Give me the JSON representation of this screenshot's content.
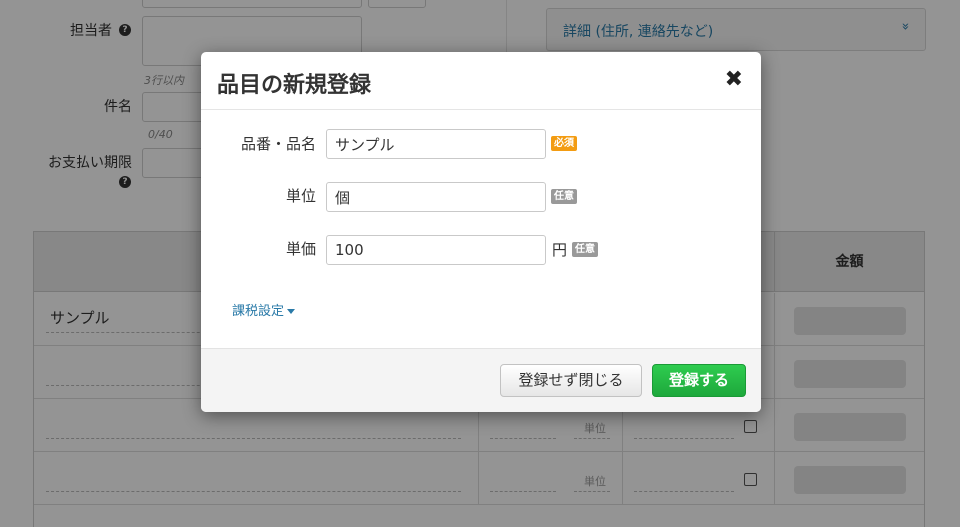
{
  "background": {
    "assignee_label": "担当者",
    "assignee_hint": "3行以内",
    "subject_label": "件名",
    "subject_counter": "0/40",
    "payment_due_label": "お支払い期限",
    "help_glyph": "?",
    "detail_toggle": "詳細 (住所, 連絡先など)",
    "detail_chevron": "»",
    "table": {
      "amount_header": "金額",
      "first_row_name": "サンプル",
      "unit_placeholder": "単位"
    }
  },
  "modal": {
    "title": "品目の新規登録",
    "close_glyph": "✖",
    "fields": {
      "name_label": "品番・品名",
      "name_value": "サンプル",
      "required_badge": "必須",
      "unit_label": "単位",
      "unit_value": "個",
      "price_label": "単価",
      "price_value": "100",
      "currency": "円",
      "optional_badge": "任意"
    },
    "tax_settings_link": "課税設定",
    "buttons": {
      "cancel": "登録せず閉じる",
      "save": "登録する"
    }
  },
  "colors": {
    "link": "#2a7aa8",
    "primary_button": "#1ea83c",
    "required_badge": "#f39c12",
    "optional_badge": "#999999"
  }
}
